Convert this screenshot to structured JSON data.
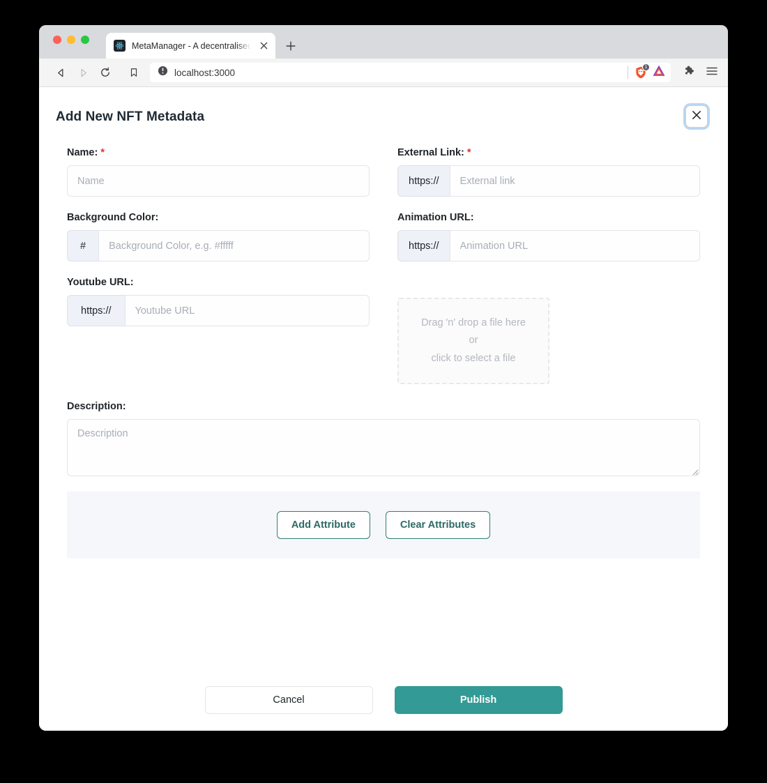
{
  "browser": {
    "tab": {
      "title": "MetaManager - A decentralised",
      "favicon_icon": "react-logo-icon",
      "close_icon": "close-icon"
    },
    "new_tab_icon": "plus-icon",
    "nav": {
      "back_icon": "back-arrow-icon",
      "forward_icon": "forward-arrow-icon",
      "reload_icon": "reload-icon",
      "bookmark_icon": "bookmark-icon"
    },
    "url": "localhost:3000",
    "url_security_icon": "not-secure-info-icon",
    "shield": {
      "icon": "brave-shield-lion-icon",
      "badge_count": "1"
    },
    "brave_logo_icon": "brave-triangle-logo-icon",
    "extensions_icon": "puzzle-piece-icon",
    "menu_icon": "hamburger-menu-icon"
  },
  "modal": {
    "title": "Add New NFT Metadata",
    "close_icon": "close-icon",
    "close_label": "Close"
  },
  "form": {
    "name": {
      "label": "Name:",
      "required_marker": "*",
      "placeholder": "Name",
      "value": ""
    },
    "external_link": {
      "label": "External Link:",
      "required_marker": "*",
      "prefix": "https://",
      "placeholder": "External link",
      "value": ""
    },
    "background_color": {
      "label": "Background Color:",
      "prefix": "#",
      "placeholder": "Background Color, e.g. #fffff",
      "value": ""
    },
    "animation_url": {
      "label": "Animation URL:",
      "prefix": "https://",
      "placeholder": "Animation URL",
      "value": ""
    },
    "youtube_url": {
      "label": "Youtube URL:",
      "prefix": "https://",
      "placeholder": "Youtube URL",
      "value": ""
    },
    "dropzone": {
      "line1": "Drag 'n' drop a file here",
      "line2": "or",
      "line3": "click to select a file"
    },
    "description": {
      "label": "Description:",
      "placeholder": "Description",
      "value": ""
    }
  },
  "attributes": {
    "add_label": "Add Attribute",
    "clear_label": "Clear Attributes"
  },
  "footer": {
    "cancel_label": "Cancel",
    "publish_label": "Publish"
  },
  "colors": {
    "accent_teal": "#339a95",
    "attr_border_teal": "#2f7d75",
    "required_red": "#e03131",
    "panel_bg": "#f6f7fb",
    "addon_bg": "#eef1f7"
  }
}
